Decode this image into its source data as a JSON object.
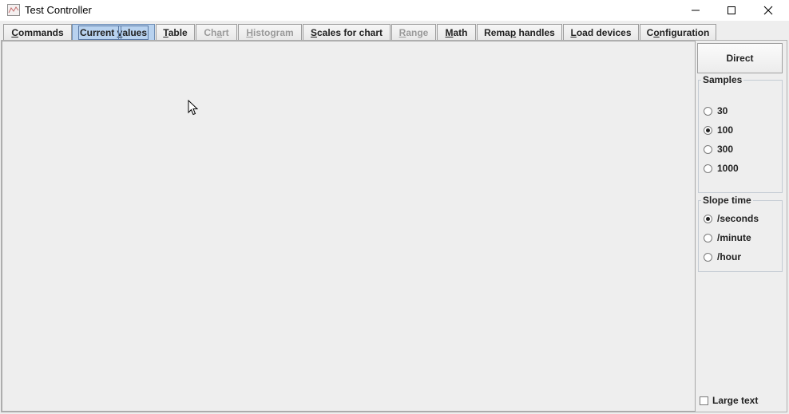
{
  "window": {
    "title": "Test Controller",
    "icons": {
      "app": "chart-app-icon",
      "minimize": "minimize-icon",
      "maximize": "maximize-icon",
      "close": "close-icon"
    }
  },
  "tabs": [
    {
      "label_pre": "",
      "mnemonic": "C",
      "label_post": "ommands",
      "state": "normal"
    },
    {
      "label_pre": "Current ",
      "mnemonic": "v",
      "label_post": "alues",
      "state": "selected"
    },
    {
      "label_pre": "",
      "mnemonic": "T",
      "label_post": "able",
      "state": "normal"
    },
    {
      "label_pre": "Ch",
      "mnemonic": "a",
      "label_post": "rt",
      "state": "disabled"
    },
    {
      "label_pre": "",
      "mnemonic": "H",
      "label_post": "istogram",
      "state": "disabled"
    },
    {
      "label_pre": "",
      "mnemonic": "S",
      "label_post": "cales for chart",
      "state": "normal"
    },
    {
      "label_pre": "",
      "mnemonic": "R",
      "label_post": "ange",
      "state": "disabled"
    },
    {
      "label_pre": "",
      "mnemonic": "M",
      "label_post": "ath",
      "state": "normal"
    },
    {
      "label_pre": "Rema",
      "mnemonic": "p",
      "label_post": " handles",
      "state": "normal"
    },
    {
      "label_pre": "",
      "mnemonic": "L",
      "label_post": "oad devices",
      "state": "normal"
    },
    {
      "label_pre": "C",
      "mnemonic": "o",
      "label_post": "nfiguration",
      "state": "normal"
    }
  ],
  "side": {
    "direct_label": "Direct",
    "samples": {
      "title": "Samples",
      "options": [
        "30",
        "100",
        "300",
        "1000"
      ],
      "selected": "100"
    },
    "slope": {
      "title": "Slope time",
      "options": [
        "/seconds",
        "/minute",
        "/hour"
      ],
      "selected": "/seconds"
    },
    "large_text": {
      "label": "Large text",
      "checked": false
    }
  },
  "colors": {
    "selected_tab": "#b8d2ef",
    "panel_bg": "#eeeeee"
  }
}
